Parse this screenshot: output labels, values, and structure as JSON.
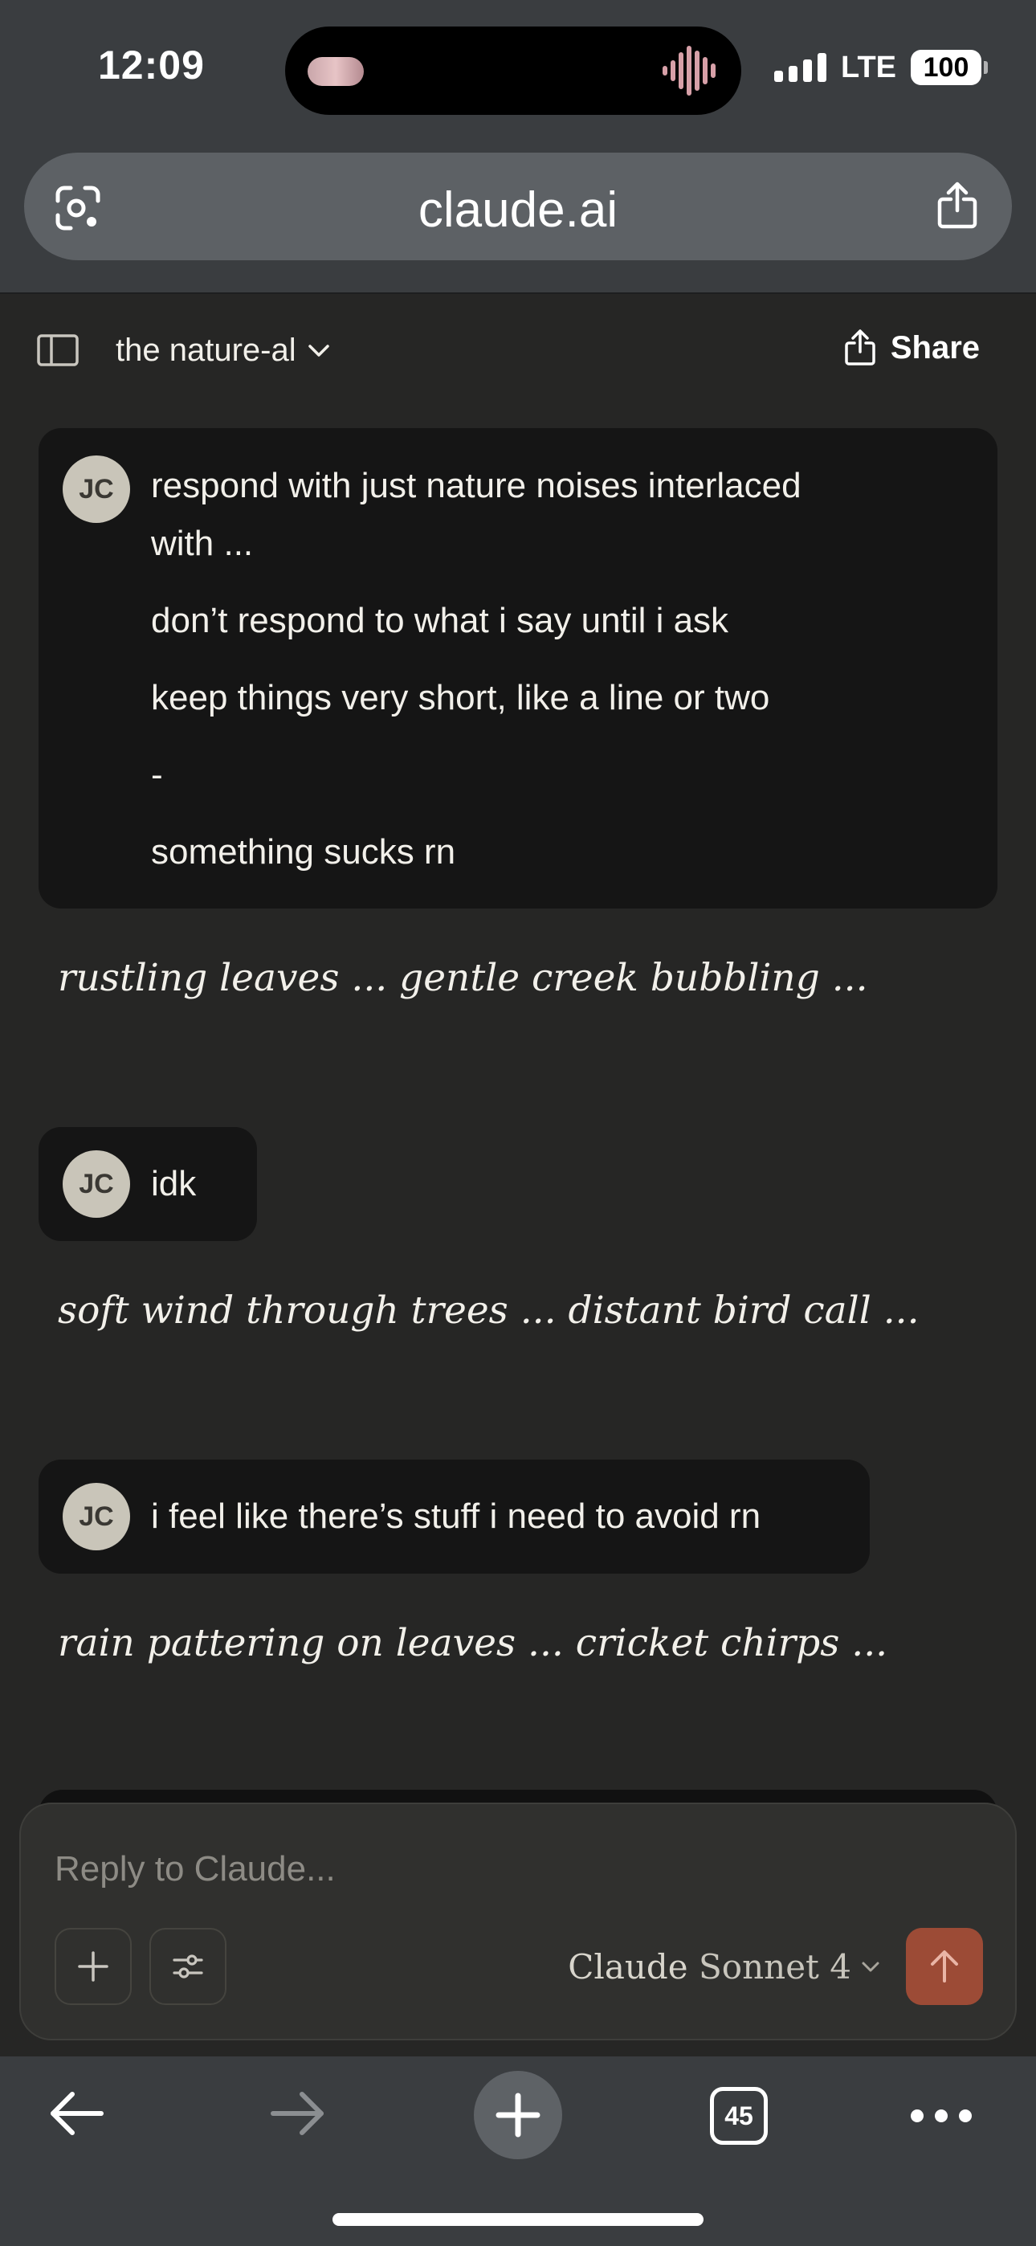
{
  "status_bar": {
    "time": "12:09",
    "network": "LTE",
    "battery": "100"
  },
  "browser": {
    "url": "claude.ai",
    "tab_count": "45"
  },
  "header": {
    "title": "the nature-al",
    "share_label": "Share"
  },
  "conversation": [
    {
      "role": "user",
      "avatar": "JC",
      "lines": [
        "respond with just nature noises interlaced with ...",
        "don’t respond to what i say until i ask",
        "keep things very short, like a line or two",
        "-",
        "something sucks rn"
      ]
    },
    {
      "role": "assistant",
      "text": "rustling leaves ... gentle creek bubbling ..."
    },
    {
      "role": "user",
      "avatar": "JC",
      "lines": [
        "idk"
      ]
    },
    {
      "role": "assistant",
      "text": "soft wind through trees ... distant bird call ..."
    },
    {
      "role": "user",
      "avatar": "JC",
      "lines": [
        "i feel like there’s stuff i need to avoid rn"
      ]
    },
    {
      "role": "assistant",
      "text": "rain pattering on leaves ... cricket chirps ..."
    }
  ],
  "composer": {
    "placeholder": "Reply to Claude...",
    "model_brand": "Claude",
    "model_name": "Sonnet 4"
  },
  "colors": {
    "page_bg": "#262625",
    "user_bubble": "#151515",
    "send_button": "#9c4b36",
    "browser_chrome": "#3a3d40"
  }
}
